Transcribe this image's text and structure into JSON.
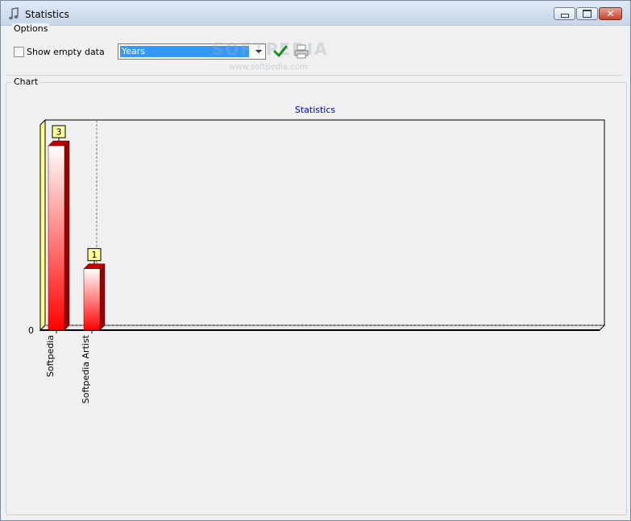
{
  "window": {
    "title": "Statistics",
    "icons": {
      "app": "music-note-icon",
      "minimize": "minimize-icon",
      "maximize": "maximize-icon",
      "close": "close-icon"
    }
  },
  "options": {
    "group_label": "Options",
    "show_empty_label": "Show empty data",
    "show_empty_checked": false,
    "period_value": "Years",
    "apply_icon": "checkmark-icon",
    "print_icon": "printer-icon"
  },
  "watermark": {
    "text": "SOFTPEDIA",
    "url": "www.softpedia.com"
  },
  "chart": {
    "group_label": "Chart"
  },
  "chart_data": {
    "type": "bar",
    "title": "Statistics",
    "categories": [
      "Softpedia",
      "Softpedia Artist"
    ],
    "values": [
      3,
      1
    ],
    "data_labels": [
      "3",
      "1"
    ],
    "y_tick_labels": [
      "0"
    ],
    "ylim": [
      0,
      3
    ],
    "xlabel": "",
    "ylabel": "",
    "grid": false,
    "colors": {
      "bar_top": "#ffffff",
      "bar_bottom": "#ff0000",
      "bar_side": "#9b0000",
      "wall": "#ffff88",
      "label_bg": "#ffff99",
      "title": "#0000cc"
    }
  }
}
